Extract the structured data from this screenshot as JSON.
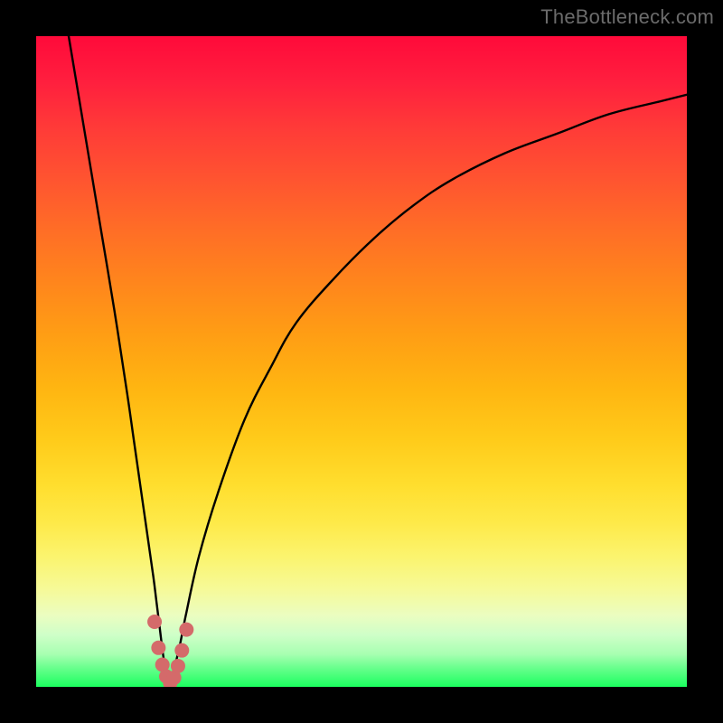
{
  "watermark": "TheBottleneck.com",
  "chart_data": {
    "type": "line",
    "title": "",
    "xlabel": "",
    "ylabel": "",
    "xlim": [
      0,
      100
    ],
    "ylim": [
      0,
      100
    ],
    "grid": false,
    "legend": false,
    "series": [
      {
        "name": "bottleneck-curve",
        "x": [
          5,
          6,
          8,
          10,
          12,
          14,
          15,
          16,
          17,
          18,
          18.5,
          19,
          19.5,
          20,
          20.5,
          21,
          22,
          23,
          25,
          28,
          32,
          36,
          40,
          46,
          52,
          58,
          64,
          72,
          80,
          88,
          96,
          100
        ],
        "y": [
          100,
          94,
          82,
          70,
          58,
          45,
          38,
          31,
          24,
          17,
          13,
          9,
          5,
          2,
          0.5,
          2,
          6,
          11,
          20,
          30,
          41,
          49,
          56,
          63,
          69,
          74,
          78,
          82,
          85,
          88,
          90,
          91
        ]
      }
    ],
    "markers": [
      {
        "name": "highlight-dots",
        "color": "#d46a6a",
        "radius_px": 8,
        "points": [
          {
            "x": 18.2,
            "y": 10.0
          },
          {
            "x": 18.8,
            "y": 6.0
          },
          {
            "x": 19.4,
            "y": 3.4
          },
          {
            "x": 20.0,
            "y": 1.6
          },
          {
            "x": 20.6,
            "y": 0.6
          },
          {
            "x": 21.2,
            "y": 1.4
          },
          {
            "x": 21.8,
            "y": 3.2
          },
          {
            "x": 22.4,
            "y": 5.6
          },
          {
            "x": 23.1,
            "y": 8.8
          }
        ]
      }
    ]
  }
}
